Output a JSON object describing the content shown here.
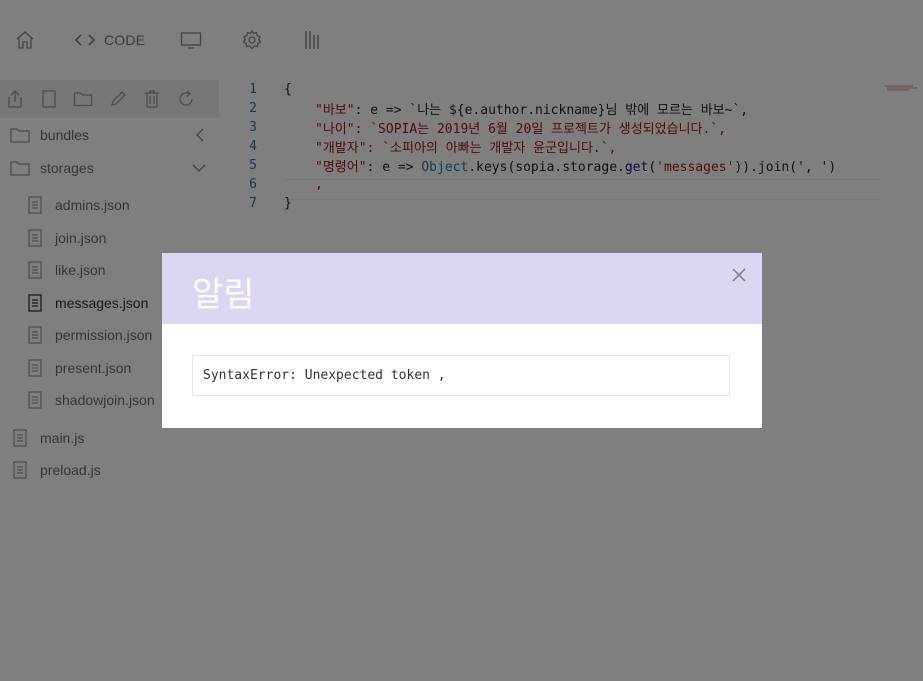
{
  "toolbar": {
    "code_label": "CODE",
    "icons": [
      "home-icon",
      "code-icon",
      "monitor-icon",
      "gear-icon",
      "bars-icon"
    ]
  },
  "sidebar": {
    "tools": [
      "export-icon",
      "new-file-icon",
      "new-folder-icon",
      "rename-icon",
      "delete-icon",
      "refresh-icon"
    ],
    "tree": [
      {
        "label": "bundles",
        "type": "folder",
        "expanded": false
      },
      {
        "label": "storages",
        "type": "folder",
        "expanded": true
      },
      {
        "label": "admins.json",
        "type": "file"
      },
      {
        "label": "join.json",
        "type": "file"
      },
      {
        "label": "like.json",
        "type": "file"
      },
      {
        "label": "messages.json",
        "type": "file",
        "selected": true
      },
      {
        "label": "permission.json",
        "type": "file"
      },
      {
        "label": "present.json",
        "type": "file"
      },
      {
        "label": "shadowjoin.json",
        "type": "file"
      },
      {
        "label": "main.js",
        "type": "file"
      },
      {
        "label": "preload.js",
        "type": "file"
      }
    ]
  },
  "editor": {
    "line_numbers": [
      "1",
      "2",
      "3",
      "4",
      "5",
      "6",
      "7"
    ],
    "line1": "{",
    "line2_key": "\"바보\"",
    "line2_rest": ": e => `나는 ${e.author.nickname}님 밖에 모르는 바보~`,",
    "line3_key": "\"나이\"",
    "line3_rest": ": `SOPIA는 2019년 6월 20일 프로젝트가 생성되었습니다.`,",
    "line4_key": "\"개발자\"",
    "line4_rest": ": `소피아의 아빠는 개발자 윤군입니다.`,",
    "line5_key": "\"명령어\"",
    "line5_a": ": e => ",
    "line5_type": "Object",
    "line5_b": ".keys(sopia.storage.",
    "line5_fn": "get",
    "line5_c": "(",
    "line5_str": "'messages'",
    "line5_d": ")).join(', ')",
    "line6": ",",
    "line7": "}"
  },
  "modal": {
    "title": "알림",
    "error_message": "SyntaxError: Unexpected token ,"
  },
  "colors": {
    "modal_header": "#ddd6f3",
    "overlay": "rgba(0,0,0,0.5)",
    "string": "#a31515",
    "line_number": "#237893"
  }
}
